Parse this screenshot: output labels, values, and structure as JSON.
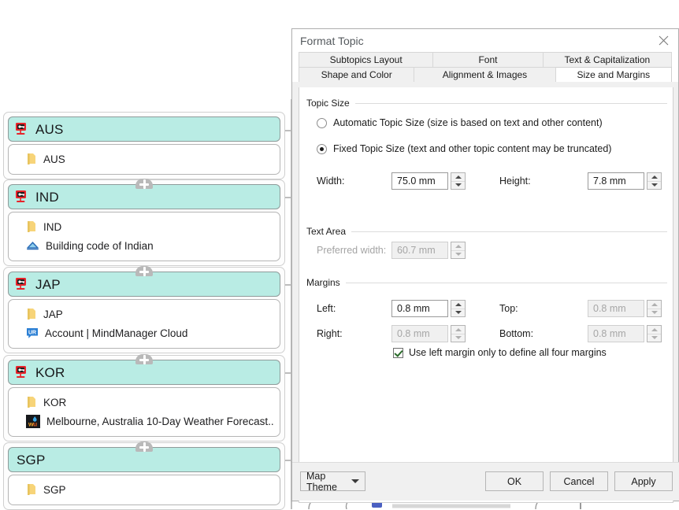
{
  "mindmap": {
    "groups": [
      {
        "header": {
          "label": "AUS",
          "icon": "remote-key-icon"
        },
        "subtopics": [
          {
            "label": "AUS",
            "icon": "folder-icon"
          }
        ]
      },
      {
        "header": {
          "label": "IND",
          "icon": "remote-key-icon"
        },
        "subtopics": [
          {
            "label": "IND",
            "icon": "folder-icon"
          },
          {
            "label": "Building code of Indian",
            "icon": "blue-triangle-link-icon"
          }
        ]
      },
      {
        "header": {
          "label": "JAP",
          "icon": "remote-key-icon"
        },
        "subtopics": [
          {
            "label": "JAP",
            "icon": "folder-icon"
          },
          {
            "label": "Account | MindManager Cloud",
            "icon": "ur-badge-icon"
          }
        ]
      },
      {
        "header": {
          "label": "KOR",
          "icon": "remote-key-icon"
        },
        "subtopics": [
          {
            "label": "KOR",
            "icon": "folder-icon"
          },
          {
            "label": "Melbourne, Australia 10-Day Weather Forecast...",
            "icon": "weather-underground-icon"
          }
        ]
      },
      {
        "header": {
          "label": "SGP",
          "icon": "none"
        },
        "subtopics": [
          {
            "label": "SGP",
            "icon": "folder-icon"
          }
        ]
      }
    ],
    "expander_label": "+"
  },
  "dialog": {
    "title": "Format Topic",
    "close_icon": "close-icon",
    "tabs_row1": [
      {
        "label": "Subtopics Layout",
        "active": false
      },
      {
        "label": "Font",
        "active": false
      },
      {
        "label": "Text & Capitalization",
        "active": false
      }
    ],
    "tabs_row2": [
      {
        "label": "Shape and Color",
        "active": false
      },
      {
        "label": "Alignment & Images",
        "active": false
      },
      {
        "label": "Size and Margins",
        "active": true
      }
    ],
    "topic_size": {
      "group_title": "Topic Size",
      "option_auto": "Automatic Topic Size (size is based on text and other content)",
      "option_fixed": "Fixed Topic Size (text and other topic content may be truncated)",
      "selected": "fixed",
      "width_label": "Width:",
      "width_value": "75.0 mm",
      "height_label": "Height:",
      "height_value": "7.8 mm"
    },
    "text_area": {
      "group_title": "Text Area",
      "preferred_width_label": "Preferred width:",
      "preferred_width_value": "60.7 mm"
    },
    "margins": {
      "group_title": "Margins",
      "left_label": "Left:",
      "left_value": "0.8 mm",
      "top_label": "Top:",
      "top_value": "0.8 mm",
      "right_label": "Right:",
      "right_value": "0.8 mm",
      "bottom_label": "Bottom:",
      "bottom_value": "0.8 mm",
      "use_left_only_label": "Use left margin only to define all four margins",
      "use_left_only_checked": true
    },
    "footer": {
      "map_theme_label": "Map Theme",
      "ok_label": "OK",
      "cancel_label": "Cancel",
      "apply_label": "Apply"
    }
  },
  "colors": {
    "topic_header_fill": "#b9ece4",
    "dialog_chrome": "#f0f0f0",
    "accent_red": "#e8232a",
    "spine": "#bdbdbd"
  }
}
